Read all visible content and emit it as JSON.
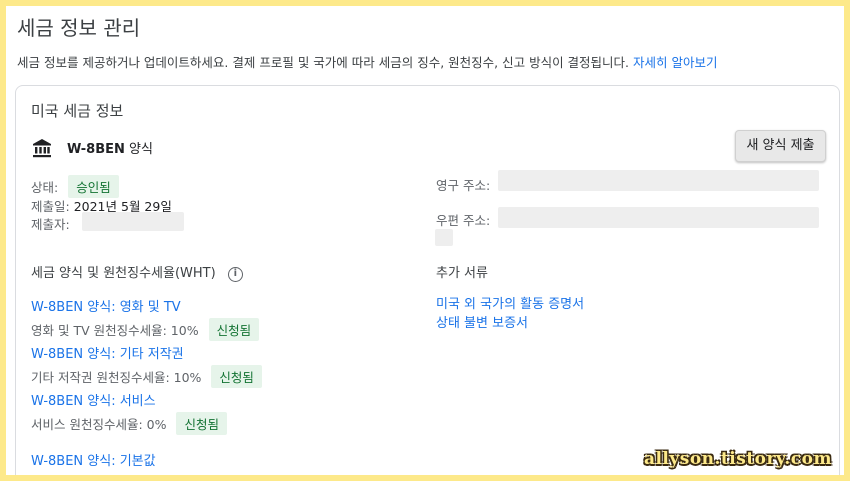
{
  "page": {
    "title": "세금 정보 관리",
    "description": "세금 정보를 제공하거나 업데이트하세요. 결제 프로필 및 국가에 따라 세금의 징수, 원천징수, 신고 방식이 결정됩니다.",
    "learn_more": "자세히 알아보기"
  },
  "card": {
    "title": "미국 세금 정보",
    "form_code": "W-8BEN",
    "form_suffix": " 양식",
    "submit_button": "새 양식 제출",
    "status_label": "상태:",
    "status_value": "승인됨",
    "submitted_label": "제출일:",
    "submitted_value": "2021년 5월 29일",
    "submitter_label": "제출자:",
    "permanent_address_label": "영구 주소:",
    "mailing_address_label": "우편 주소:"
  },
  "wht": {
    "title": "세금 양식 및 원천징수세율(WHT)",
    "items": [
      {
        "link": "W-8BEN 양식: 영화 및 TV",
        "rate_text": "영화 및 TV 원천징수세율: 10%",
        "badge": "신청됨"
      },
      {
        "link": "W-8BEN 양식: 기타 저작권",
        "rate_text": "기타 저작권 원천징수세율: 10%",
        "badge": "신청됨"
      },
      {
        "link": "W-8BEN 양식: 서비스",
        "rate_text": "서비스 원천징수세율: 0%",
        "badge": "신청됨"
      },
      {
        "link": "W-8BEN 양식: 기본값"
      }
    ]
  },
  "additional_docs": {
    "title": "추가 서류",
    "links": [
      "미국 외 국가의 활동 증명서",
      "상태 불변 보증서"
    ]
  },
  "watermark": "allyson.tistory.com",
  "colors": {
    "background": "#fde98a",
    "link": "#1a73e8",
    "badge_bg": "#e6f4ea",
    "badge_text": "#137333"
  },
  "icons": {
    "form_icon": "bank-icon",
    "info": "info-icon"
  }
}
